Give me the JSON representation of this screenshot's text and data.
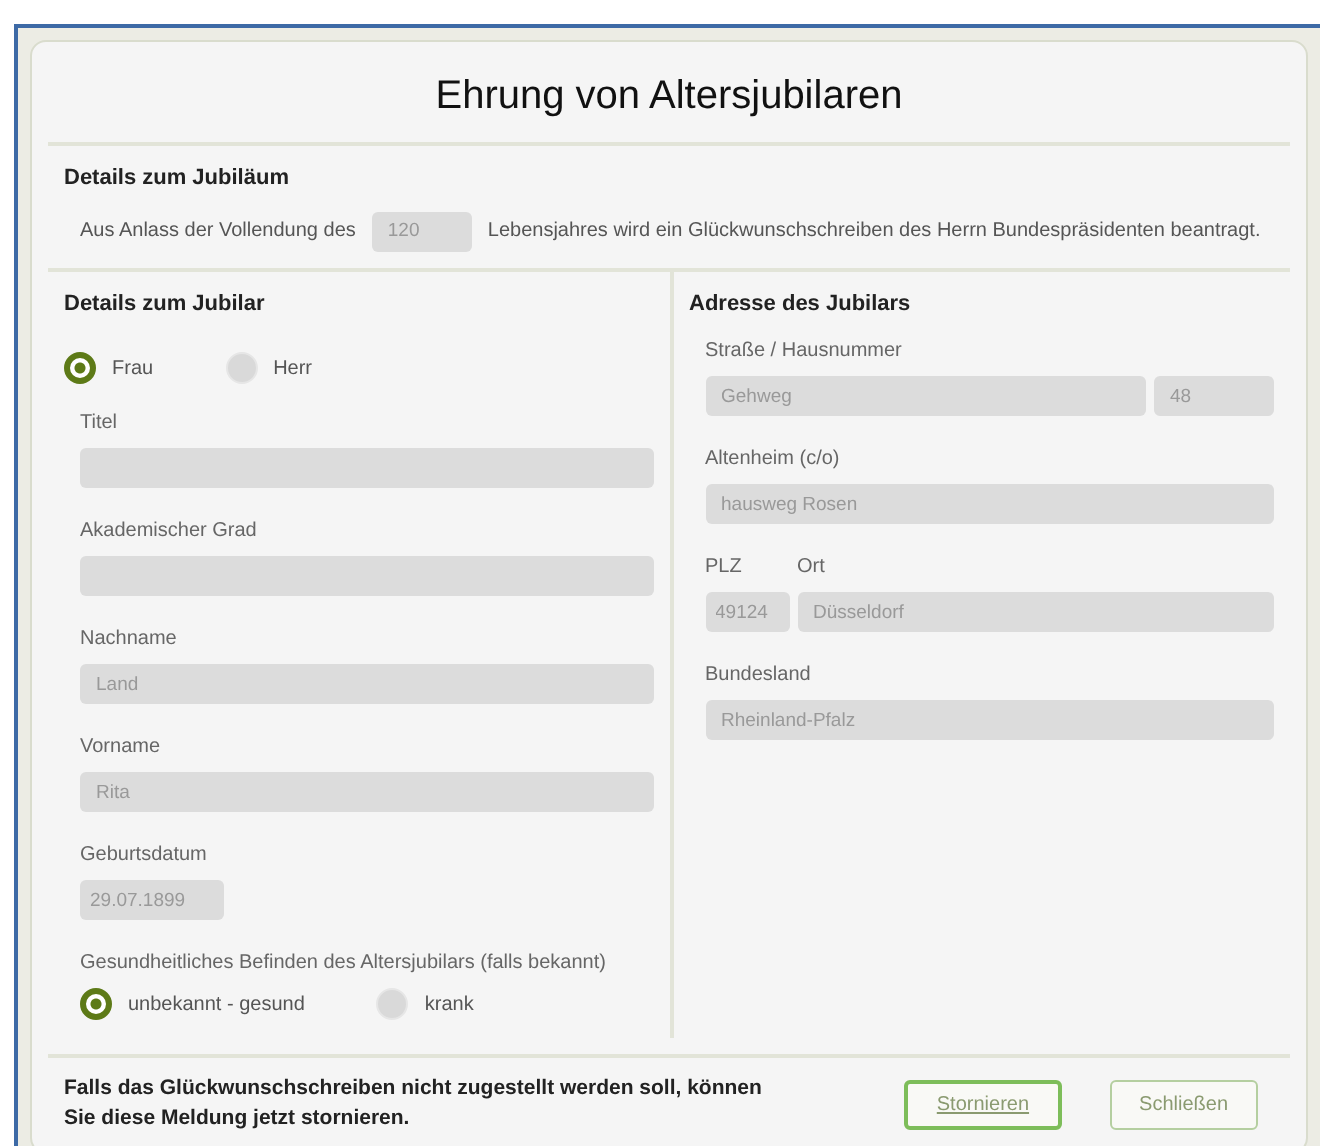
{
  "title": "Ehrung von Altersjubilaren",
  "anniversary": {
    "heading": "Details zum Jubiläum",
    "text_before": "Aus Anlass der Vollendung des",
    "age": {
      "value": "120",
      "disabled": true
    },
    "text_after": "Lebensjahres wird ein Glückwunschschreiben des Herrn Bundespräsidenten beantragt."
  },
  "person": {
    "heading": "Details zum Jubilar",
    "salutation": [
      {
        "label": "Frau",
        "selected": true
      },
      {
        "label": "Herr",
        "selected": false
      }
    ],
    "fields": [
      {
        "kind": "text",
        "label": "Titel",
        "disabled": true
      },
      {
        "kind": "text",
        "label": "Akademischer Grad",
        "disabled": true
      },
      {
        "kind": "text",
        "label": "Nachname",
        "value": "Land",
        "disabled": true
      },
      {
        "kind": "text",
        "label": "Vorname",
        "value": "Rita",
        "disabled": true
      },
      {
        "kind": "date",
        "label": "Geburtsdatum",
        "value": "29.07.1899",
        "disabled": true
      }
    ],
    "health": {
      "label": "Gesundheitliches Befinden des Altersjubilars (falls bekannt)",
      "options": [
        {
          "label": "unbekannt - gesund",
          "selected": true
        },
        {
          "label": "krank",
          "selected": false
        }
      ]
    }
  },
  "address": {
    "heading": "Adresse des Jubilars",
    "rows": [
      {
        "kind": "street",
        "labels": [
          "Straße / Hausnummer"
        ],
        "values": [
          "Gehweg",
          "48"
        ],
        "disabled": true
      },
      {
        "kind": "single",
        "labels": [
          "Altenheim (c/o)"
        ],
        "values": [
          "hausweg Rosen"
        ],
        "disabled": true
      },
      {
        "kind": "city",
        "labels": [
          "PLZ",
          "Ort"
        ],
        "values": [
          "49124",
          "Düsseldorf"
        ],
        "disabled": true
      },
      {
        "kind": "single",
        "labels": [
          "Bundesland"
        ],
        "values": [
          "Rheinland-Pfalz"
        ],
        "disabled": true
      }
    ]
  },
  "footer": {
    "message": "Falls das Glückwunschschreiben nicht zugestellt werden soll, können Sie diese Meldung jetzt stornieren.",
    "buttons": [
      {
        "label": "Stornieren",
        "focused": true
      },
      {
        "label": "Schließen",
        "focused": false
      }
    ]
  }
}
